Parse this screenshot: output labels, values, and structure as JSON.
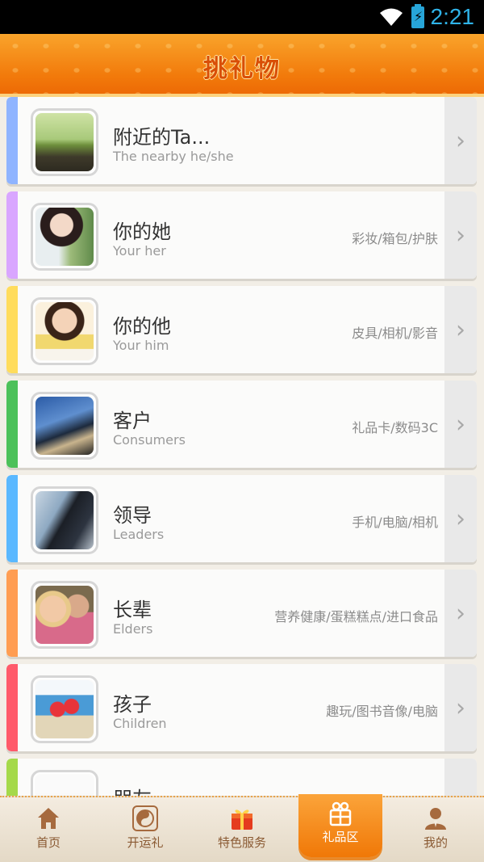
{
  "status_bar": {
    "time": "2:21",
    "icons": [
      "wifi-icon",
      "battery-charging-icon"
    ]
  },
  "header": {
    "title": "挑礼物"
  },
  "categories": [
    {
      "name_cn": "附近的Ta...",
      "name_en": "The nearby he/she",
      "tags": "",
      "color": "#8fb4ff"
    },
    {
      "name_cn": "你的她",
      "name_en": "Your her",
      "tags": "彩妆/箱包/护肤",
      "color": "#d9a6ff"
    },
    {
      "name_cn": "你的他",
      "name_en": "Your him",
      "tags": "皮具/相机/影音",
      "color": "#ffdc5c"
    },
    {
      "name_cn": "客户",
      "name_en": "Consumers",
      "tags": "礼品卡/数码3C",
      "color": "#4cc15a"
    },
    {
      "name_cn": "领导",
      "name_en": "Leaders",
      "tags": "手机/电脑/相机",
      "color": "#5ab8ff"
    },
    {
      "name_cn": "长辈",
      "name_en": "Elders",
      "tags": "营养健康/蛋糕糕点/进口食品",
      "color": "#ff9d52"
    },
    {
      "name_cn": "孩子",
      "name_en": "Children",
      "tags": "趣玩/图书音像/电脑",
      "color": "#ff5a6a"
    },
    {
      "name_cn": "朋友",
      "name_en": "",
      "tags": "",
      "color": "#a5d94a"
    }
  ],
  "bottom_nav": [
    {
      "label": "首页",
      "icon": "home-icon"
    },
    {
      "label": "开运礼",
      "icon": "yin-yang-icon"
    },
    {
      "label": "特色服务",
      "icon": "gift-box-icon"
    },
    {
      "label": "礼品区",
      "icon": "gift-icon",
      "active": true
    },
    {
      "label": "我的",
      "icon": "user-icon"
    }
  ],
  "colors": {
    "accent": "#f27a0b",
    "title": "#d94e07",
    "nav_text": "#8a5a33"
  }
}
